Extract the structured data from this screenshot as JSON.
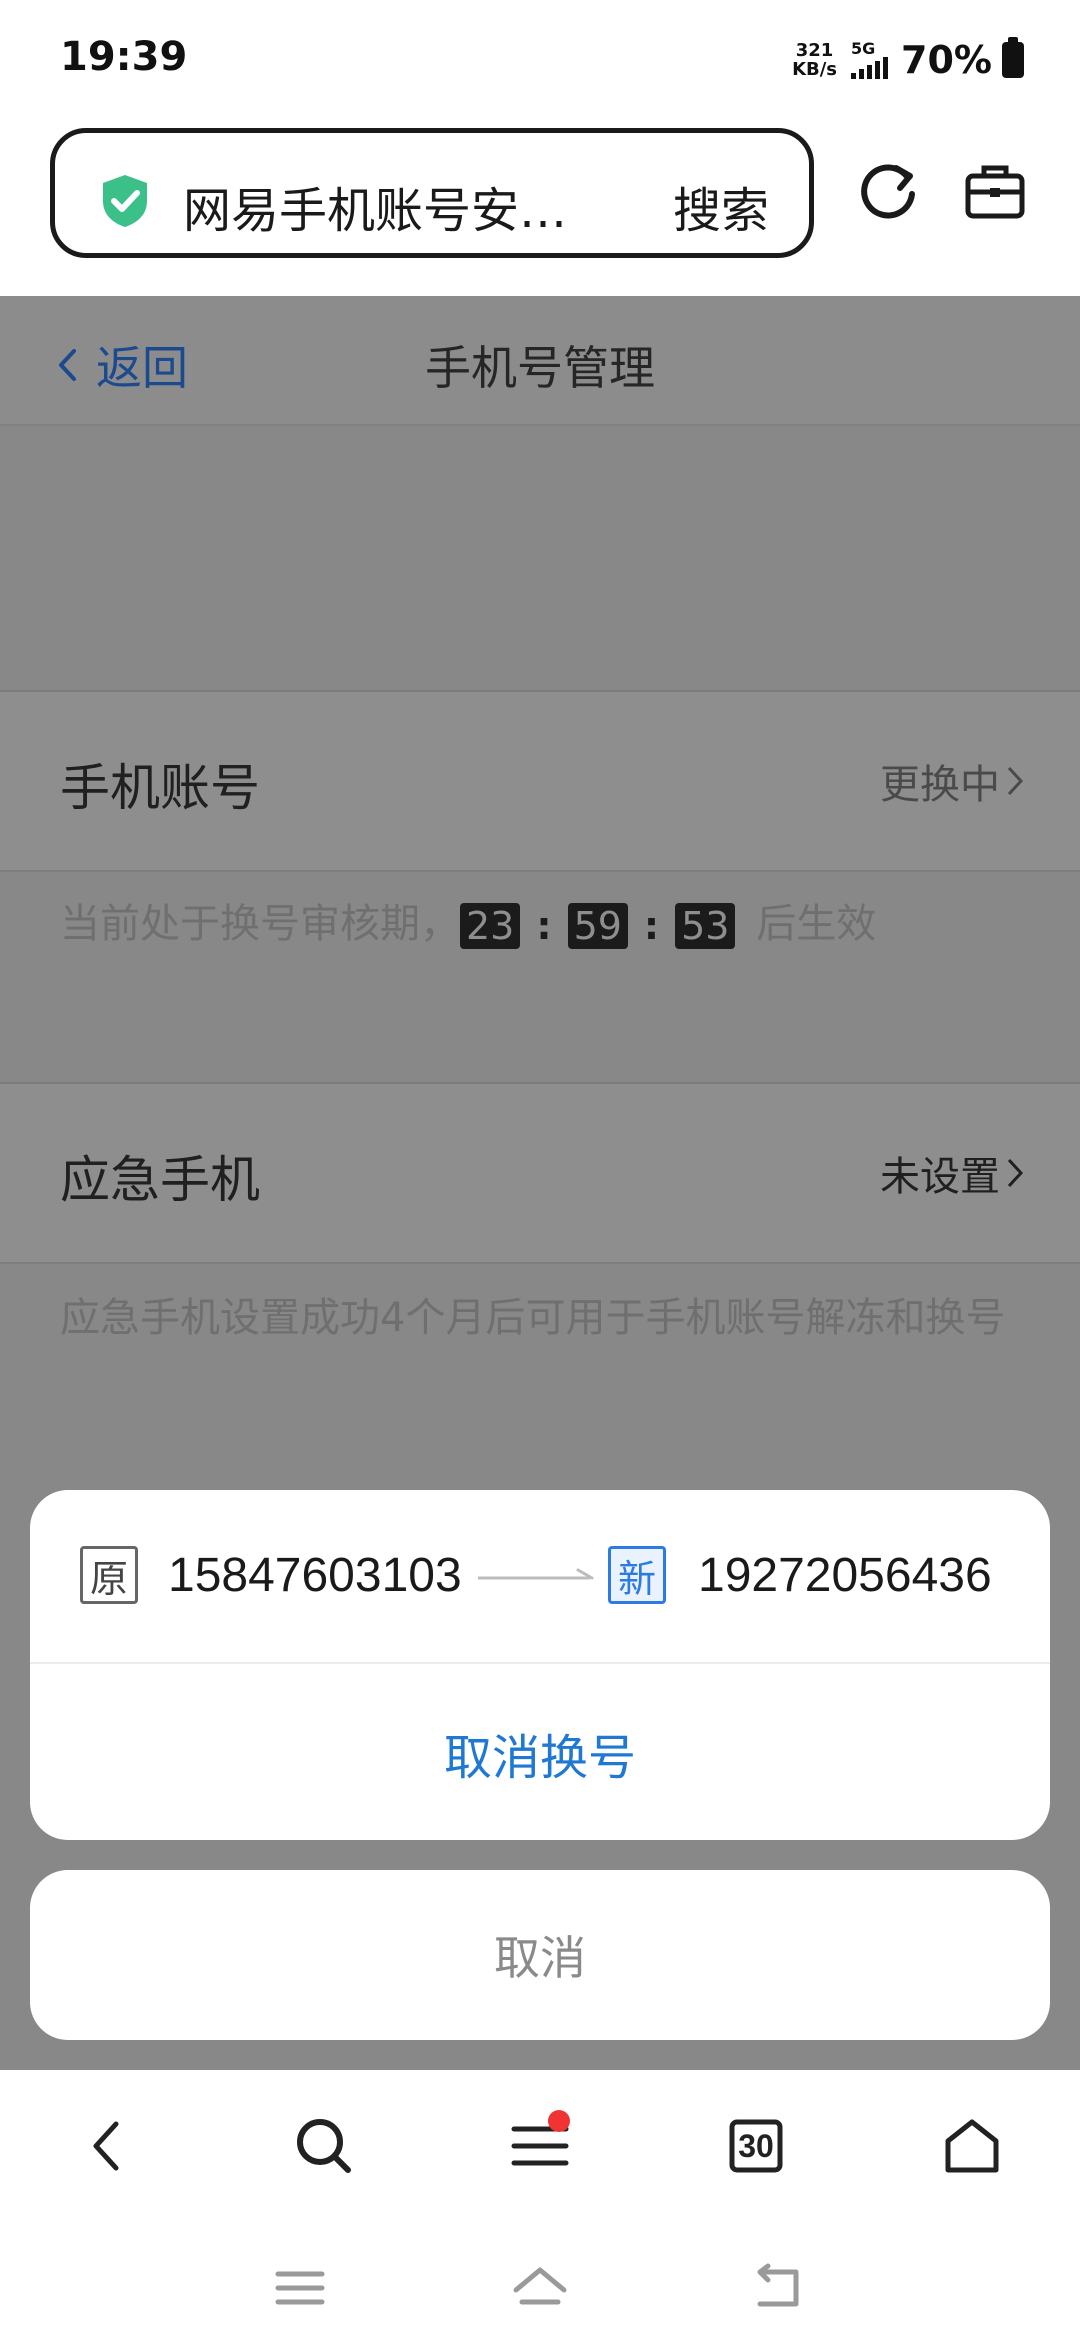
{
  "status_bar": {
    "time": "19:39",
    "net_speed_value": "321",
    "net_speed_unit": "KB/s",
    "network_type": "5G",
    "battery": "70%"
  },
  "address_bar": {
    "page_title": "网易手机账号安…",
    "search_label": "搜索",
    "shield_color": "#3cc08a"
  },
  "page": {
    "back_label": "返回",
    "title": "手机号管理",
    "phone_account": {
      "label": "手机账号",
      "status": "更换中"
    },
    "review_notice": {
      "prefix": "当前处于换号审核期，",
      "hours": "23",
      "minutes": "59",
      "seconds": "53",
      "suffix": "后生效"
    },
    "emergency_phone": {
      "label": "应急手机",
      "status": "未设置",
      "description": "应急手机设置成功4个月后可用于手机账号解冻和换号"
    }
  },
  "sheet": {
    "old_tag": "原",
    "old_number": "15847603103",
    "new_tag": "新",
    "new_number": "19272056436",
    "cancel_swap_label": "取消换号",
    "cancel_label": "取消",
    "accent_color": "#1f78d1"
  },
  "toolbar": {
    "tabs_count": "30"
  }
}
